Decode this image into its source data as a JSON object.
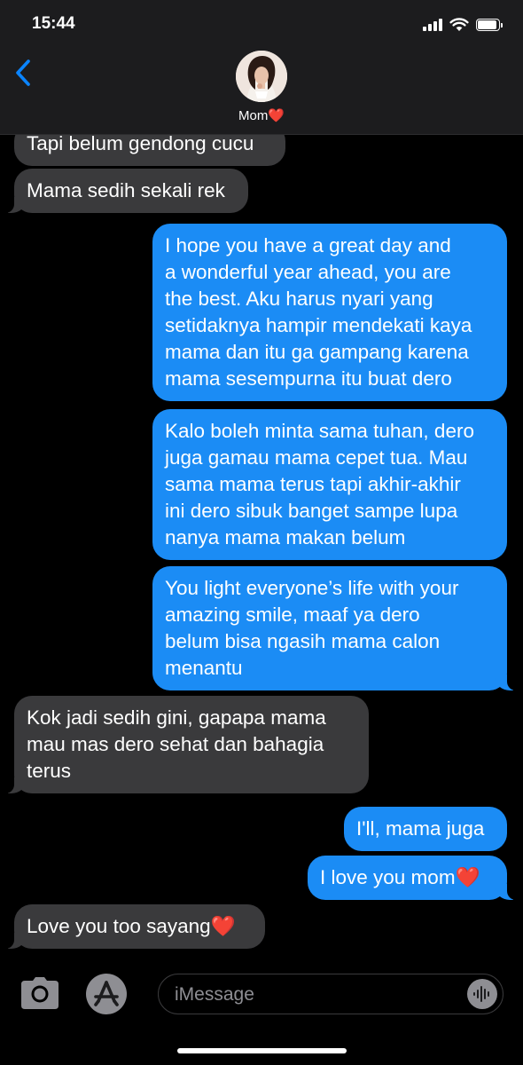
{
  "status_bar": {
    "time": "15:44",
    "battery_level": 0.9
  },
  "header": {
    "back_icon": "chevron-left-icon",
    "contact_name": "Mom",
    "contact_emoji": "❤️"
  },
  "messages": [
    {
      "direction": "incoming",
      "lines": [
        "Tapi belum gendong cucu"
      ]
    },
    {
      "direction": "incoming",
      "lines": [
        "Mama sedih sekali rek"
      ]
    },
    {
      "direction": "outgoing",
      "lines": [
        "I hope you have a great day and",
        "a wonderful year ahead, you are",
        "the best. Aku harus nyari yang",
        "setidaknya hampir mendekati kaya",
        "mama dan itu ga gampang karena",
        "mama sesempurna itu buat dero"
      ]
    },
    {
      "direction": "outgoing",
      "lines": [
        "Kalo boleh minta sama tuhan, dero",
        "juga gamau mama cepet tua. Mau",
        "sama mama terus tapi akhir-akhir",
        "ini dero sibuk banget sampe lupa",
        "nanya mama makan belum"
      ]
    },
    {
      "direction": "outgoing",
      "lines": [
        "You light everyone’s life with your",
        "amazing smile, maaf ya dero",
        "belum bisa ngasih mama calon",
        "menantu"
      ]
    },
    {
      "direction": "incoming",
      "lines": [
        "Kok jadi sedih gini, gapapa mama",
        "mau mas dero sehat dan bahagia",
        "terus"
      ]
    },
    {
      "direction": "outgoing",
      "lines": [
        "I'll, mama juga"
      ]
    },
    {
      "direction": "outgoing",
      "lines": [
        "I love you mom"
      ],
      "emoji": "❤️"
    },
    {
      "direction": "incoming",
      "lines": [
        "Love you too sayang"
      ],
      "emoji": "❤️"
    }
  ],
  "input_bar": {
    "camera_icon": "camera-icon",
    "apps_icon": "app-store-icon",
    "placeholder": "iMessage",
    "audio_icon": "audio-waveform-icon"
  },
  "colors": {
    "outgoing_bubble": "#1b8cf5",
    "incoming_bubble": "#3a3a3c",
    "accent": "#0a84ff",
    "heart": "#e0112b"
  }
}
